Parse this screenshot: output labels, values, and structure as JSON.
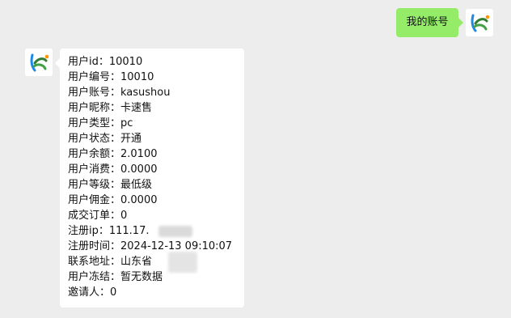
{
  "user_message": {
    "text": "我的账号"
  },
  "bot_message": {
    "lines": [
      "用户id：10010",
      "用户编号：10010",
      "用户账号：kasushou",
      "用户昵称：卡速售",
      "用户类型：pc",
      "用户状态：开通",
      "用户余额：2.0100",
      "用户消费：0.0000",
      "用户等级：最低级",
      "用户佣金：0.0000",
      "成交订单：0",
      "注册ip：111.17.",
      "注册时间：2024-12-13 09:10:07",
      "联系地址：山东省",
      "用户冻结：暂无数据",
      "邀请人：0"
    ]
  },
  "icons": {
    "avatar_icon": "kasushou-logo-icon",
    "redaction_ip": "blurred-ip-region",
    "redaction_address": "blurred-address-region"
  },
  "colors": {
    "background": "#ededed",
    "user_bubble": "#95ec69",
    "bot_bubble": "#ffffff",
    "text": "#111111"
  }
}
